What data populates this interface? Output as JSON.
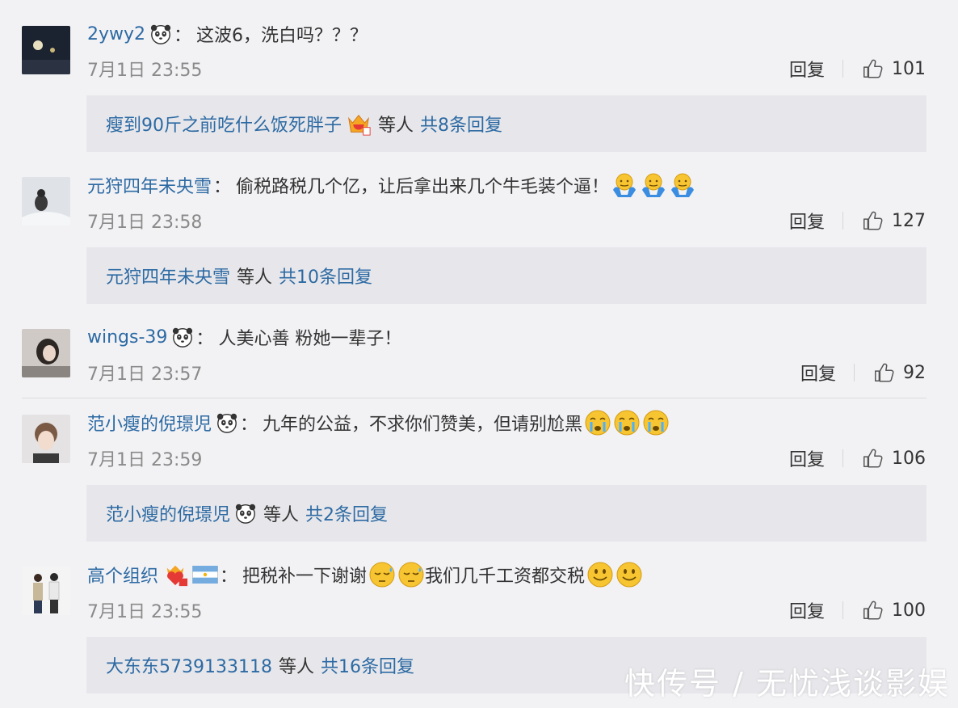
{
  "comments": [
    {
      "username": "2ywy2",
      "text": "这波6，洗白吗？？？",
      "time": "7月1日 23:55",
      "reply_label": "回复",
      "likes": "101",
      "sub": {
        "name": "瘦到90斤之前吃什么饭死胖子",
        "others": "等人",
        "count_label": "共8条回复"
      }
    },
    {
      "username": "元狩四年未央雪",
      "text": "偷税路税几个亿，让后拿出来几个牛毛装个逼！",
      "time": "7月1日 23:58",
      "reply_label": "回复",
      "likes": "127",
      "sub": {
        "name": "元狩四年未央雪",
        "others": "等人",
        "count_label": "共10条回复"
      }
    },
    {
      "username": "wings-39",
      "text": "人美心善 粉她一辈子！",
      "time": "7月1日 23:57",
      "reply_label": "回复",
      "likes": "92"
    },
    {
      "username": "范小瘦的倪璟児",
      "text": "九年的公益，不求你们赞美，但请别尬黑",
      "time": "7月1日 23:59",
      "reply_label": "回复",
      "likes": "106",
      "sub": {
        "name": "范小瘦的倪璟児",
        "others": "等人",
        "count_label": "共2条回复"
      }
    },
    {
      "username": "高个组织",
      "text_a": "把税补一下谢谢",
      "text_b": "我们几千工资都交税",
      "time": "7月1日 23:55",
      "reply_label": "回复",
      "likes": "100",
      "sub": {
        "name": "大东东5739133118",
        "others": "等人",
        "count_label": "共16条回复"
      }
    }
  ],
  "watermark": "快传号 / 无忧浅谈影娱",
  "colors": {
    "link": "#2d6aa3",
    "background": "#f2f2f5",
    "subbox": "#e7e7eb"
  }
}
